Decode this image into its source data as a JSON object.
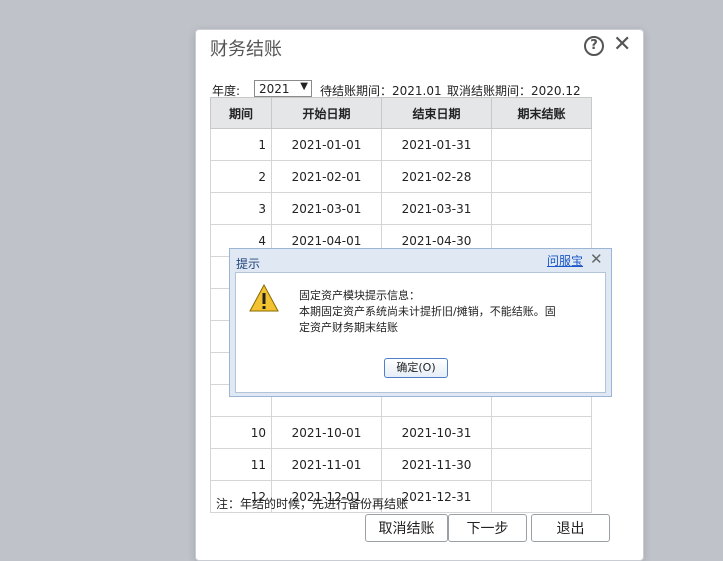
{
  "dialog": {
    "title": "财务结账",
    "year_label": "年度:",
    "year_value": "2021",
    "pending_period": "待结账期间：2021.01",
    "cancel_period": "取消结账期间：2020.12",
    "columns": [
      "期间",
      "开始日期",
      "结束日期",
      "期末结账"
    ],
    "rows": [
      {
        "period": "1",
        "start": "2021-01-01",
        "end": "2021-01-31",
        "closed": ""
      },
      {
        "period": "2",
        "start": "2021-02-01",
        "end": "2021-02-28",
        "closed": ""
      },
      {
        "period": "3",
        "start": "2021-03-01",
        "end": "2021-03-31",
        "closed": ""
      },
      {
        "period": "4",
        "start": "2021-04-01",
        "end": "2021-04-30",
        "closed": ""
      },
      {
        "period": "",
        "start": "",
        "end": "",
        "closed": ""
      },
      {
        "period": "",
        "start": "",
        "end": "",
        "closed": ""
      },
      {
        "period": "",
        "start": "",
        "end": "",
        "closed": ""
      },
      {
        "period": "",
        "start": "",
        "end": "",
        "closed": ""
      },
      {
        "period": "",
        "start": "",
        "end": "",
        "closed": ""
      },
      {
        "period": "10",
        "start": "2021-10-01",
        "end": "2021-10-31",
        "closed": ""
      },
      {
        "period": "11",
        "start": "2021-11-01",
        "end": "2021-11-30",
        "closed": ""
      },
      {
        "period": "12",
        "start": "2021-12-01",
        "end": "2021-12-31",
        "closed": ""
      }
    ],
    "note": "注：年结的时候，先进行备份再结账",
    "buttons": {
      "cancel_close": "取消结账",
      "next": "下一步",
      "exit": "退出"
    }
  },
  "alert": {
    "title": "提示",
    "link": "问服宝",
    "close": "✕",
    "message_lines": [
      "固定资产模块提示信息：",
      "本期固定资产系统尚未计提折旧/摊销，不能结账。固",
      "定资产财务期末结账"
    ],
    "ok_button": "确定(O)"
  },
  "colors": {
    "backdrop": "#bfc2c9",
    "alert_title": "#23457a",
    "link": "#1a56c9",
    "warning": "#f2c230"
  }
}
